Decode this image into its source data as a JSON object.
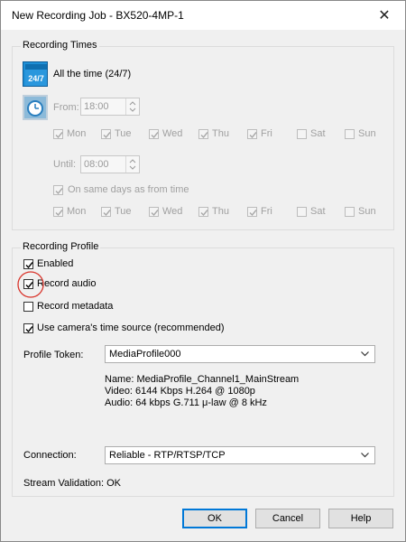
{
  "window": {
    "title": "New Recording Job - BX520-4MP-1"
  },
  "recording_times": {
    "title": "Recording Times",
    "all_time_icon_text": "24/7",
    "all_time_label": "All the time (24/7)",
    "from_label": "From:",
    "from_value": "18:00",
    "until_label": "Until:",
    "until_value": "08:00",
    "same_days_label": "On same days as from time",
    "days": [
      "Mon",
      "Tue",
      "Wed",
      "Thu",
      "Fri",
      "Sat",
      "Sun"
    ]
  },
  "recording_profile": {
    "title": "Recording Profile",
    "enabled_label": "Enabled",
    "record_audio_label": "Record audio",
    "record_metadata_label": "Record metadata",
    "camera_time_label": "Use camera's time source (recommended)",
    "profile_token_label": "Profile Token:",
    "profile_token_value": "MediaProfile000",
    "info_name": "Name: MediaProfile_Channel1_MainStream",
    "info_video": "Video: 6144 Kbps H.264 @ 1080p",
    "info_audio": "Audio: 64 kbps G.711 μ-law @ 8 kHz",
    "connection_label": "Connection:",
    "connection_value": "Reliable - RTP/RTSP/TCP",
    "stream_validation": "Stream Validation: OK"
  },
  "buttons": {
    "ok": "OK",
    "cancel": "Cancel",
    "help": "Help"
  },
  "colors": {
    "icon_blue": "#1e8fd6",
    "highlight_circle": "#d9342b",
    "default_button_border": "#0078d7"
  }
}
